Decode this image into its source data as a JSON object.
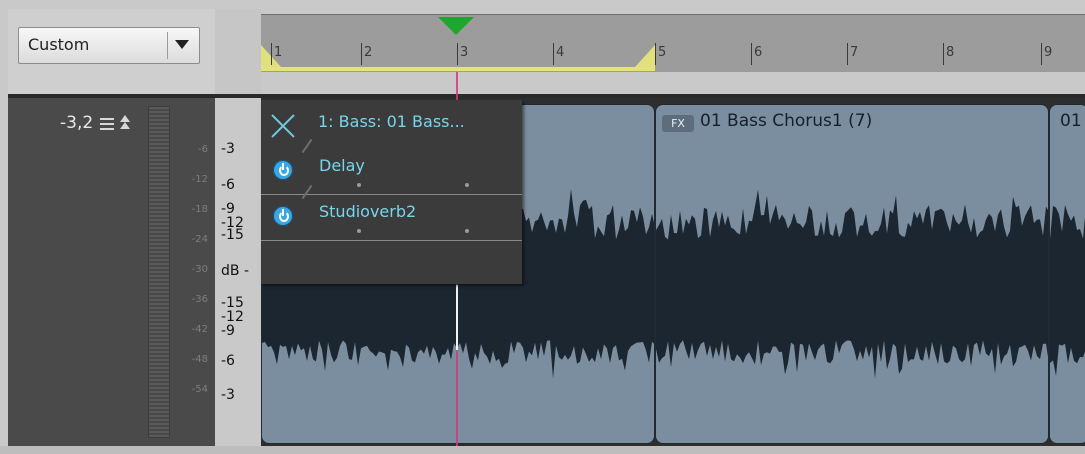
{
  "preset": {
    "value": "Custom"
  },
  "ruler": {
    "marks": [
      "1",
      "2",
      "3",
      "4",
      "5",
      "6",
      "7",
      "8",
      "9"
    ]
  },
  "track": {
    "volume": "-3,2",
    "meter_scale": [
      "-6",
      "-12",
      "-18",
      "-24",
      "-30",
      "-36",
      "-42",
      "-48",
      "-54"
    ]
  },
  "db_scale": {
    "labels": [
      "-3",
      "-6",
      "-9",
      "-12",
      "-15",
      "dB -",
      "-15",
      "-12",
      "-9",
      "-6",
      "-3"
    ]
  },
  "fx_popup": {
    "title": "1: Bass: 01 Bass...",
    "effects": [
      "Delay",
      "Studioverb2"
    ]
  },
  "clips": [
    {
      "badge": "FX",
      "title": "01 Bass Chorus1 (7)"
    },
    {
      "title": "01"
    }
  ],
  "colors": {
    "clip": "#7b8ea0",
    "waveform": "#1c2630",
    "fx_text": "#79d5ea",
    "playhead_marker": "#1fa62f",
    "loop": "#e4e27a"
  }
}
